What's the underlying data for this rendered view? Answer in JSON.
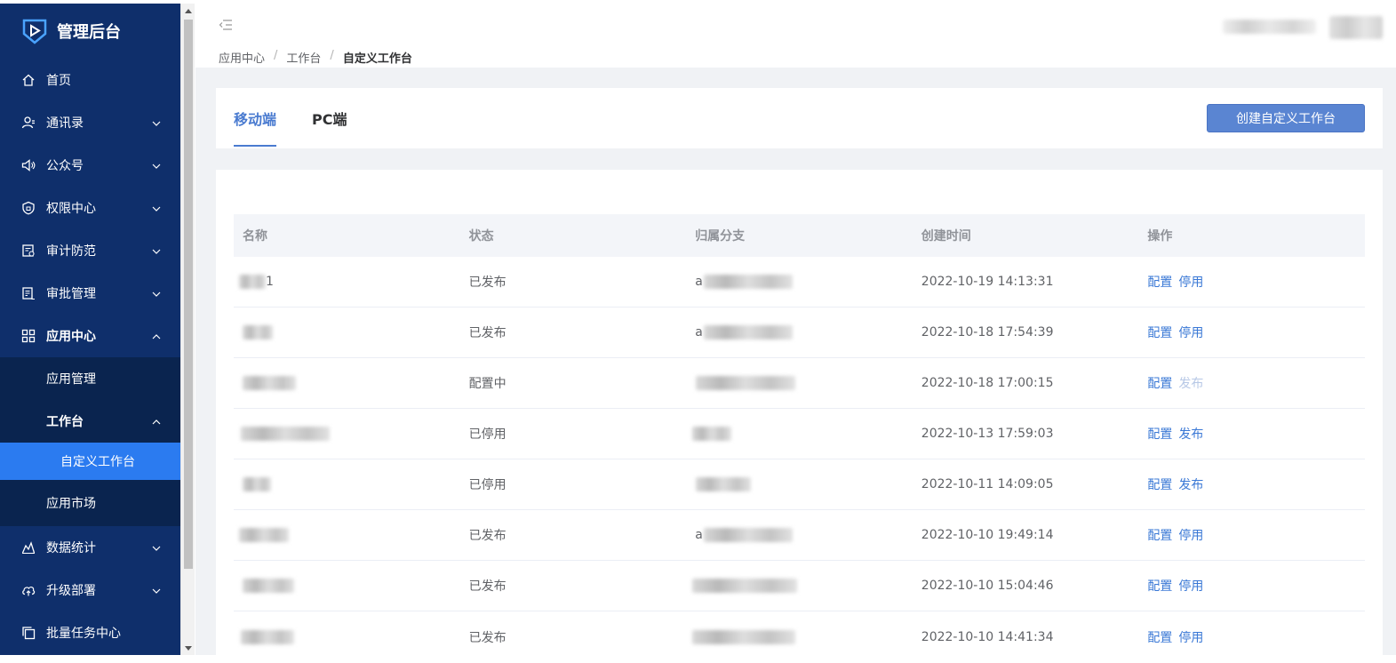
{
  "brand": {
    "title": "管理后台"
  },
  "sidebar": {
    "items": [
      {
        "label": "首页",
        "icon": "home-icon",
        "expandable": false
      },
      {
        "label": "通讯录",
        "icon": "contacts-icon",
        "expandable": true
      },
      {
        "label": "公众号",
        "icon": "speaker-icon",
        "expandable": true
      },
      {
        "label": "权限中心",
        "icon": "shield-icon",
        "expandable": true
      },
      {
        "label": "审计防范",
        "icon": "audit-icon",
        "expandable": true
      },
      {
        "label": "审批管理",
        "icon": "approval-icon",
        "expandable": true
      },
      {
        "label": "应用中心",
        "icon": "grid-icon",
        "expandable": true,
        "expanded": true
      }
    ],
    "app_center_sub": {
      "app_manage": "应用管理",
      "workbench": "工作台",
      "custom_workbench": "自定义工作台",
      "app_market": "应用市场"
    },
    "bottom_items": [
      {
        "label": "数据统计",
        "icon": "chart-icon"
      },
      {
        "label": "升级部署",
        "icon": "cloud-upload-icon"
      },
      {
        "label": "批量任务中心",
        "icon": "copy-icon"
      }
    ]
  },
  "breadcrumb": {
    "items": [
      "应用中心",
      "工作台"
    ],
    "current": "自定义工作台",
    "separator": "/"
  },
  "tabs": {
    "mobile": "移动端",
    "pc": "PC端",
    "active": "mobile"
  },
  "create_button": "创建自定义工作台",
  "table": {
    "headers": [
      "名称",
      "状态",
      "归属分支",
      "创建时间",
      "操作"
    ],
    "rows": [
      {
        "name_suffix": "1",
        "status": "已发布",
        "branch_prefix": "a",
        "time": "2022-10-19 14:13:31",
        "actions": [
          "配置",
          "停用"
        ],
        "second_disabled": false
      },
      {
        "name_suffix": "",
        "status": "已发布",
        "branch_prefix": "a",
        "time": "2022-10-18 17:54:39",
        "actions": [
          "配置",
          "停用"
        ],
        "second_disabled": false
      },
      {
        "name_suffix": "",
        "status": "配置中",
        "branch_prefix": "",
        "time": "2022-10-18 17:00:15",
        "actions": [
          "配置",
          "发布"
        ],
        "second_disabled": true
      },
      {
        "name_suffix": "",
        "status": "已停用",
        "branch_prefix": "",
        "time": "2022-10-13 17:59:03",
        "actions": [
          "配置",
          "发布"
        ],
        "second_disabled": false
      },
      {
        "name_suffix": "",
        "status": "已停用",
        "branch_prefix": "",
        "time": "2022-10-11 14:09:05",
        "actions": [
          "配置",
          "发布"
        ],
        "second_disabled": false
      },
      {
        "name_suffix": "",
        "status": "已发布",
        "branch_prefix": "a",
        "time": "2022-10-10 19:49:14",
        "actions": [
          "配置",
          "停用"
        ],
        "second_disabled": false
      },
      {
        "name_suffix": "",
        "status": "已发布",
        "branch_prefix": "",
        "time": "2022-10-10 15:04:46",
        "actions": [
          "配置",
          "停用"
        ],
        "second_disabled": false
      },
      {
        "name_suffix": "",
        "status": "已发布",
        "branch_prefix": "",
        "time": "2022-10-10 14:41:34",
        "actions": [
          "配置",
          "停用"
        ],
        "second_disabled": false
      }
    ]
  },
  "colors": {
    "sidebar_bg": "#0f2f6b",
    "sidebar_active": "#2b7bf0",
    "accent": "#4a7bd0",
    "link": "#3a78d6"
  }
}
